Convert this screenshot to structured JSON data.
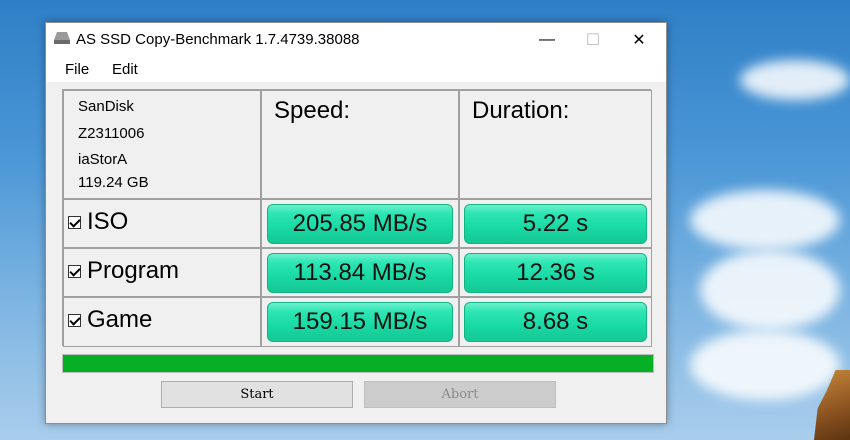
{
  "window": {
    "title": "AS SSD Copy-Benchmark 1.7.4739.38088",
    "controls": {
      "minimize": "—",
      "maximize": "☐",
      "close": "✕"
    }
  },
  "menu": {
    "file": "File",
    "edit": "Edit"
  },
  "drive": {
    "model": "SanDisk",
    "firmware": "Z2311006",
    "driver": "iaStorA",
    "capacity": "119.24 GB"
  },
  "headers": {
    "speed": "Speed:",
    "duration": "Duration:"
  },
  "rows": [
    {
      "label": "ISO",
      "checked": true,
      "speed": "205.85 MB/s",
      "duration": "5.22 s"
    },
    {
      "label": "Program",
      "checked": true,
      "speed": "113.84 MB/s",
      "duration": "12.36 s"
    },
    {
      "label": "Game",
      "checked": true,
      "speed": "159.15 MB/s",
      "duration": "8.68 s"
    }
  ],
  "progress": {
    "percent": 100,
    "color": "#06b025"
  },
  "buttons": {
    "start": "Start",
    "abort": "Abort"
  },
  "colors": {
    "result_green": "#2ee6b4"
  }
}
